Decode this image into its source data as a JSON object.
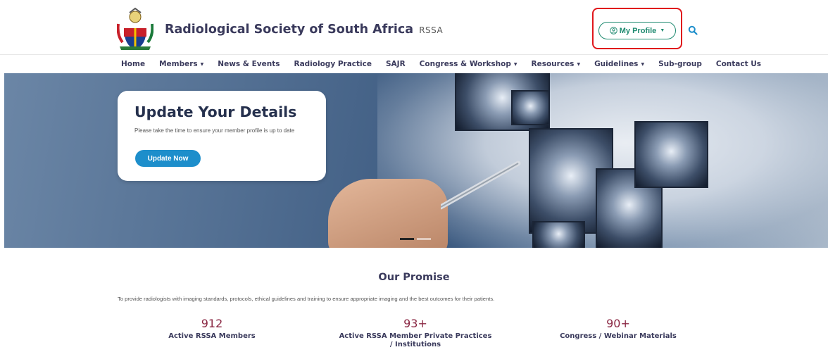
{
  "header": {
    "brand_name": "Radiological Society of South Africa",
    "brand_abbr": "RSSA",
    "profile_label": "My Profile",
    "profile_caret": "▼"
  },
  "nav": {
    "items": [
      {
        "label": "Home",
        "dropdown": false
      },
      {
        "label": "Members",
        "dropdown": true
      },
      {
        "label": "News & Events",
        "dropdown": false
      },
      {
        "label": "Radiology Practice",
        "dropdown": false
      },
      {
        "label": "SAJR",
        "dropdown": false
      },
      {
        "label": "Congress & Workshop",
        "dropdown": true
      },
      {
        "label": "Resources",
        "dropdown": true
      },
      {
        "label": "Guidelines",
        "dropdown": true
      },
      {
        "label": "Sub-group",
        "dropdown": false
      },
      {
        "label": "Contact Us",
        "dropdown": false
      }
    ],
    "caret": "▼"
  },
  "hero": {
    "card_title": "Update Your Details",
    "card_text": "Please take the time to ensure your member profile is up to date",
    "card_button": "Update Now",
    "active_slide": 1,
    "slide_count": 2
  },
  "promise": {
    "title": "Our Promise",
    "text": "To provide radiologists with imaging standards, protocols, ethical guidelines and training to ensure appropriate imaging and the best outcomes for their patients.",
    "stats": [
      {
        "number": "912",
        "label": "Active RSSA Members"
      },
      {
        "number": "93+",
        "label": "Active RSSA Member Private Practices / Institutions"
      },
      {
        "number": "90+",
        "label": "Congress / Webinar Materials"
      }
    ]
  },
  "colors": {
    "accent_green": "#1f8a70",
    "button_blue": "#1d8ecb",
    "stat_maroon": "#8a2743",
    "highlight_red": "#e0161b"
  }
}
